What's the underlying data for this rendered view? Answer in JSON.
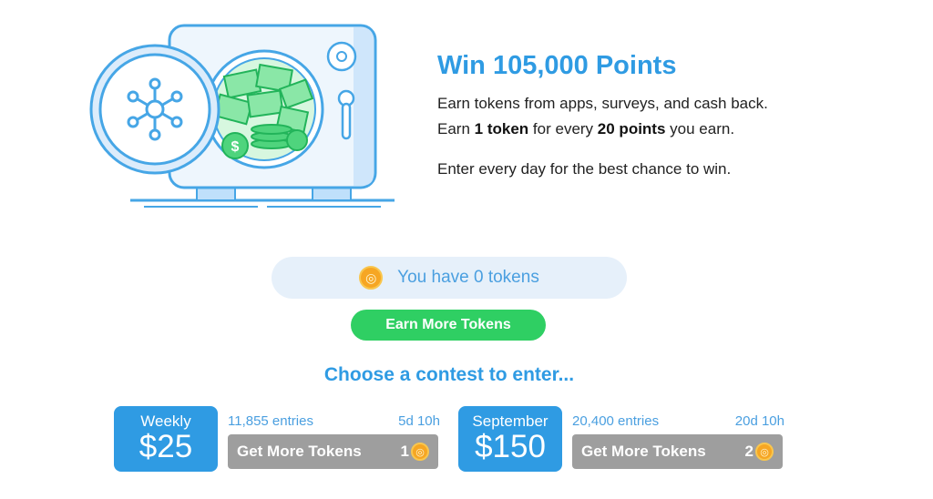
{
  "hero": {
    "title": "Win 105,000 Points",
    "line1": "Earn tokens from apps, surveys, and cash back.",
    "line2": {
      "pre": "Earn",
      "tokens": "1 token",
      "mid": "for every",
      "points": "20 points",
      "post": "you earn."
    },
    "line3": "Enter every day for the best chance to win."
  },
  "tokens": {
    "status": "You have 0 tokens"
  },
  "earn_button": "Earn More Tokens",
  "contests_heading": "Choose a contest to enter...",
  "contests": [
    {
      "period": "Weekly",
      "prize": "$25",
      "entries": "11,855 entries",
      "time_left": "5d 10h",
      "button": "Get More Tokens",
      "cost": "1"
    },
    {
      "period": "September",
      "prize": "$150",
      "entries": "20,400 entries",
      "time_left": "20d 10h",
      "button": "Get More Tokens",
      "cost": "2"
    }
  ],
  "colors": {
    "brand_blue": "#2f9be3",
    "earn_green": "#2fcf63",
    "disabled_gray": "#9e9e9e",
    "coin_gold": "#f6a623",
    "pill_bg": "#e6f0fa"
  },
  "icons": {
    "coin": "token-coin-icon",
    "vault": "vault-illustration"
  }
}
